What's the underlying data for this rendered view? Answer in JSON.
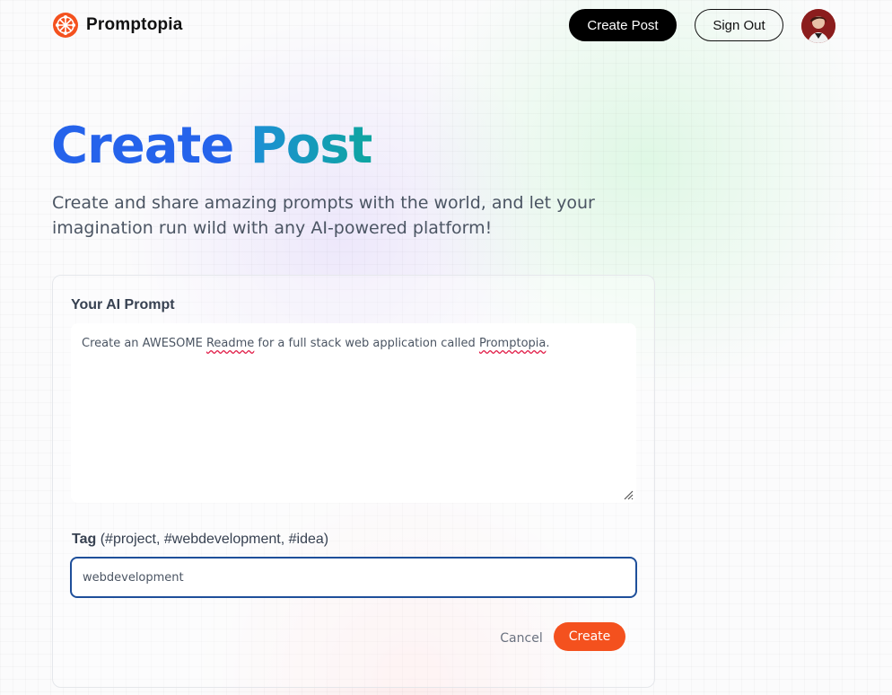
{
  "nav": {
    "logo_text": "Promptopia",
    "create_post_label": "Create Post",
    "sign_out_label": "Sign Out"
  },
  "hero": {
    "title_part1": "Create",
    "title_part2": "Post",
    "description": "Create and share amazing prompts with the world, and let your imagination run wild with any AI-powered platform!"
  },
  "form": {
    "prompt_label": "Your AI Prompt",
    "prompt_value": {
      "t1": "Create an AWESOME ",
      "t2": "Readme",
      "t3": " for a full stack web application called ",
      "t4": "Promptopia",
      "t5": "."
    },
    "tag_label_bold": "Tag",
    "tag_label_hint": "(#project, #webdevelopment, #idea)",
    "tag_value": "webdevelopment",
    "cancel_label": "Cancel",
    "create_label": "Create"
  },
  "colors": {
    "brand_orange": "#f4511e",
    "title_blue": "#2563eb",
    "input_focus": "#1e4f9a"
  },
  "icons": {
    "logo": "globe-network-icon",
    "resize": "resize-handle-icon"
  }
}
